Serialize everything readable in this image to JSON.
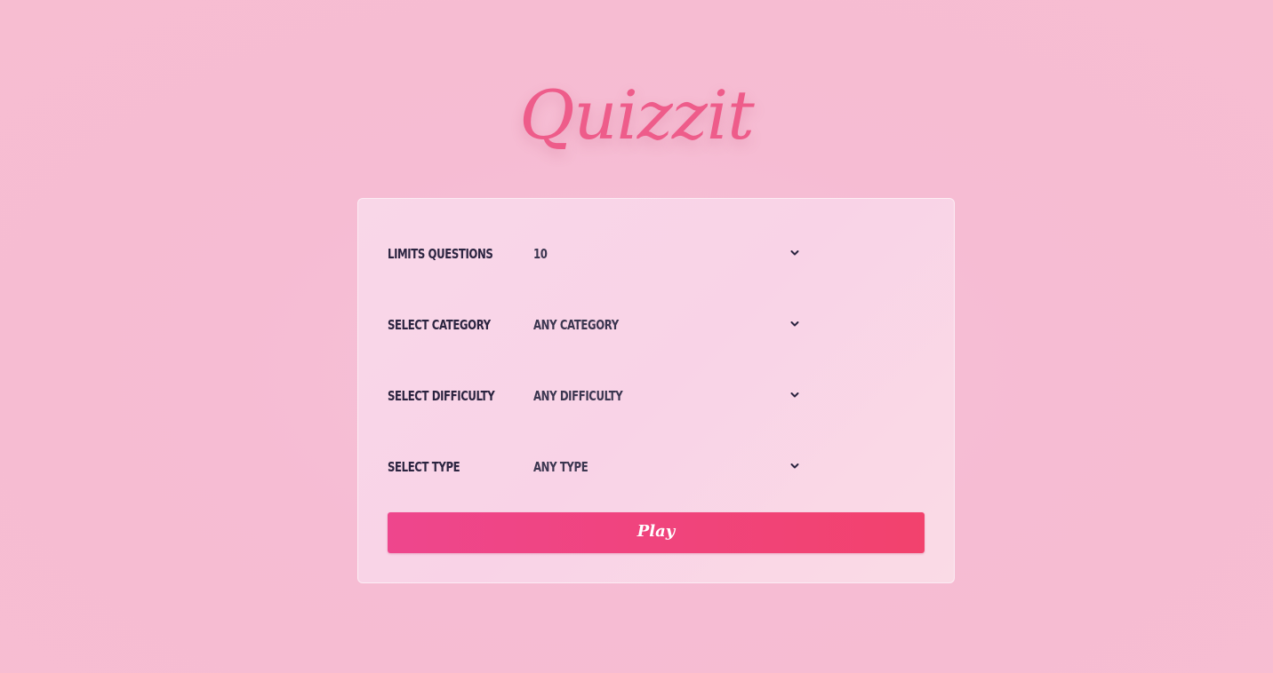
{
  "app": {
    "logo_text": "Quizzit"
  },
  "form": {
    "rows": [
      {
        "label": "Limits Questions",
        "value": "10"
      },
      {
        "label": "Select Category",
        "value": "Any Category"
      },
      {
        "label": "Select Difficulty",
        "value": "Any Difficulty"
      },
      {
        "label": "Select Type",
        "value": "Any Type"
      }
    ],
    "play_label": "Play"
  },
  "icons": {
    "dropdown": "chevron-down-icon"
  },
  "colors": {
    "accent": "#ee5c8a",
    "button_start": "#ee468d",
    "button_end": "#f2426d",
    "text": "#2b2440"
  }
}
